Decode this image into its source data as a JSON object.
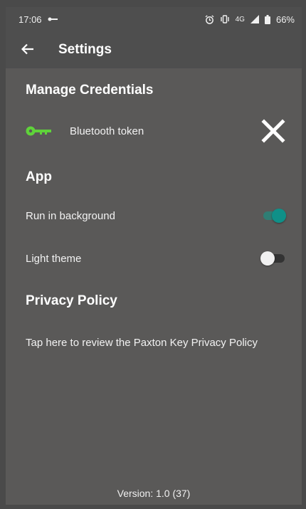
{
  "status_bar": {
    "time": "17:06",
    "battery": "66%",
    "network": "4G"
  },
  "app_bar": {
    "title": "Settings"
  },
  "credentials": {
    "heading": "Manage Credentials",
    "token_label": "Bluetooth token",
    "key_color": "#5fd33a"
  },
  "app_section": {
    "heading": "App",
    "run_in_background": {
      "label": "Run in background",
      "enabled": true
    },
    "light_theme": {
      "label": "Light theme",
      "enabled": false
    }
  },
  "privacy": {
    "heading": "Privacy Policy",
    "link_text": "Tap here to review the Paxton Key Privacy Policy"
  },
  "footer": {
    "version": "Version: 1.0 (37)"
  },
  "colors": {
    "background": "#5a5958",
    "bars": "#4e4e4e",
    "accent": "#0f9088"
  }
}
